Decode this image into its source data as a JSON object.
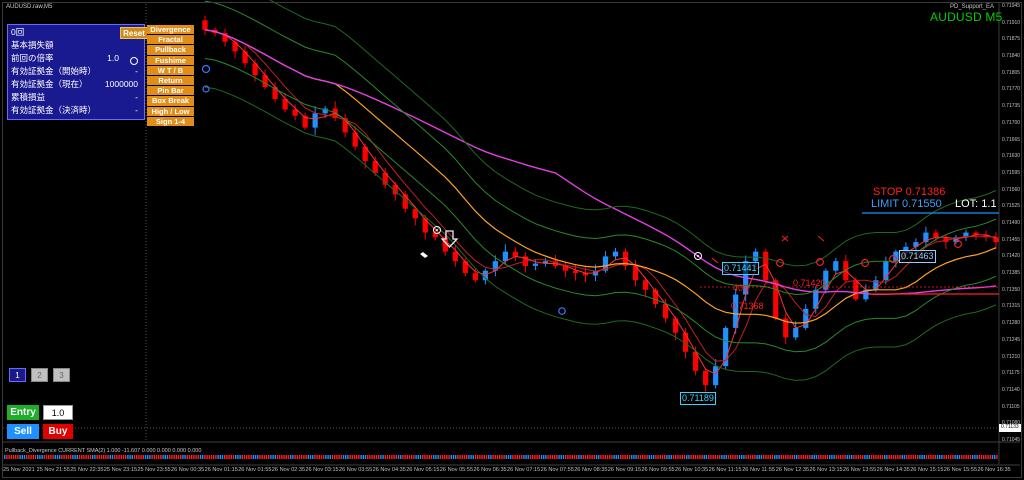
{
  "window": {
    "symbol_title": "AUDUSD.raw,M5",
    "ea_name": "PD_Support_EA",
    "pair_label": "AUDUSD M5"
  },
  "colors": {
    "background": "#000000",
    "bull_candle": "#1e90ff",
    "bear_candle": "#ff0000",
    "ma_magenta": "#e040e0",
    "ma_orange": "#ffa020",
    "band_green": "#1f6a1f",
    "panel_bg": "#1a1a90",
    "button_orange": "#e08d1a"
  },
  "panel": {
    "rows": [
      {
        "label": "0回",
        "value": ""
      },
      {
        "label": "基本損失額",
        "value": ""
      },
      {
        "label": "前回の倍率",
        "value": "1.0"
      },
      {
        "label": "有効証拠金（開始時）",
        "value": "-"
      },
      {
        "label": "有効証拠金（現在）",
        "value": "1000000"
      },
      {
        "label": "累積損益",
        "value": "-"
      },
      {
        "label": "有効証拠金（決済時）",
        "value": "-"
      }
    ],
    "reset_label": "Reset"
  },
  "patterns": [
    "Divergence",
    "Fractal",
    "Pullback",
    "Fushime",
    "W T / B",
    "Return",
    "Pin Bar",
    "Box Break",
    "High / Low",
    "Sign 1-4"
  ],
  "lots": [
    "1",
    "2",
    "3"
  ],
  "order": {
    "entry_label": "Entry",
    "entry_value": "1.0",
    "sell_label": "Sell",
    "buy_label": "Buy"
  },
  "trade": {
    "stop_text": "STOP 0.71386",
    "limit_text": "LIMIT 0.71550",
    "lot_text": "LOT: 1.1"
  },
  "chart_labels": {
    "box_upper": "0.71441",
    "box_lower": "0.71189",
    "red_a": "400",
    "red_b": "0.71368",
    "red_c": "0.71420",
    "box_right": "0.71463",
    "current_price": "0.71133"
  },
  "price_axis": [
    "0.71945",
    "0.71910",
    "0.71875",
    "0.71840",
    "0.71805",
    "0.71770",
    "0.71735",
    "0.71700",
    "0.71665",
    "0.71630",
    "0.71595",
    "0.71560",
    "0.71525",
    "0.71490",
    "0.71455",
    "0.71420",
    "0.71385",
    "0.71350",
    "0.71315",
    "0.71280",
    "0.71245",
    "0.71210",
    "0.71175",
    "0.71140",
    "0.71105",
    "0.71080",
    "0.71045"
  ],
  "indicator": {
    "label": "Pullback_Divergence CURRENT SMA(2) 1.000 -11.607 0.000 0.000 0.000 0.000"
  },
  "time_axis": [
    "25 Nov 2021",
    "25 Nov 21:55",
    "25 Nov 22:35",
    "25 Nov 23:15",
    "25 Nov 23:55",
    "26 Nov 00:35",
    "26 Nov 01:15",
    "26 Nov 01:55",
    "26 Nov 02:35",
    "26 Nov 03:15",
    "26 Nov 03:55",
    "26 Nov 04:35",
    "26 Nov 05:15",
    "26 Nov 05:55",
    "26 Nov 06:35",
    "26 Nov 07:15",
    "26 Nov 07:55",
    "26 Nov 08:35",
    "26 Nov 09:15",
    "26 Nov 09:55",
    "26 Nov 10:35",
    "26 Nov 11:15",
    "26 Nov 11:55",
    "26 Nov 12:35",
    "26 Nov 13:15",
    "26 Nov 13:55",
    "26 Nov 14:35",
    "26 Nov 15:15",
    "26 Nov 15:55",
    "26 Nov 16:35"
  ],
  "chart_data": {
    "type": "candlestick",
    "ylim": [
      0.71045,
      0.71955
    ],
    "close": [
      0.71905,
      0.71898,
      0.7188,
      0.7186,
      0.71835,
      0.7181,
      0.71785,
      0.7176,
      0.71738,
      0.71725,
      0.717,
      0.7173,
      0.7174,
      0.7172,
      0.7169,
      0.7166,
      0.7163,
      0.71605,
      0.7158,
      0.7156,
      0.7153,
      0.7151,
      0.7148,
      0.7147,
      0.7144,
      0.7142,
      0.71395,
      0.7138,
      0.714,
      0.7142,
      0.7144,
      0.7143,
      0.7141,
      0.71415,
      0.7142,
      0.7141,
      0.714,
      0.71395,
      0.7139,
      0.714,
      0.7143,
      0.7144,
      0.7141,
      0.7138,
      0.7136,
      0.7133,
      0.713,
      0.7127,
      0.7123,
      0.7119,
      0.7116,
      0.712,
      0.7128,
      0.7135,
      0.7142,
      0.7144,
      0.7138,
      0.713,
      0.7126,
      0.7128,
      0.7132,
      0.7136,
      0.714,
      0.7142,
      0.7138,
      0.7134,
      0.7136,
      0.7138,
      0.7142,
      0.7144,
      0.7145,
      0.7146,
      0.7148,
      0.7147,
      0.7146,
      0.7147,
      0.7148,
      0.71475,
      0.7147,
      0.7146
    ]
  }
}
